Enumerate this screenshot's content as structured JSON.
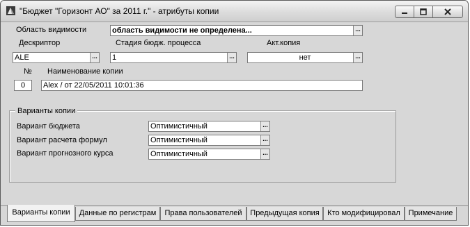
{
  "window": {
    "title": "\"Бюджет \"Горизонт АО\" за 2011 г.\" - атрибуты копии"
  },
  "form": {
    "scope_label": "Область видимости",
    "scope_value": "область видимости не определена...",
    "descriptor_label": "Дескриптор",
    "descriptor_value": "ALE",
    "stage_label": "Стадия бюдж. процесса",
    "stage_value": "1",
    "act_copy_label": "Акт.копия",
    "act_copy_value": "нет",
    "number_label": "№",
    "number_value": "0",
    "copy_name_label": "Наименование копии",
    "copy_name_value": "Alex / от 22/05/2011 10:01:36"
  },
  "variants": {
    "group_title": "Варианты копии",
    "budget_label": "Вариант бюджета",
    "budget_value": "Оптимистичный",
    "formula_label": "Вариант расчета формул",
    "formula_value": "Оптимистичный",
    "forecast_label": "Вариант прогнозного курса",
    "forecast_value": "Оптимистичный"
  },
  "ellipsis": "...",
  "tabs": [
    {
      "label": "Варианты копии",
      "active": true
    },
    {
      "label": "Данные по регистрам",
      "active": false
    },
    {
      "label": "Права пользователей",
      "active": false
    },
    {
      "label": "Предыдущая копия",
      "active": false
    },
    {
      "label": "Кто модифицировал",
      "active": false
    },
    {
      "label": "Примечание",
      "active": false
    }
  ]
}
